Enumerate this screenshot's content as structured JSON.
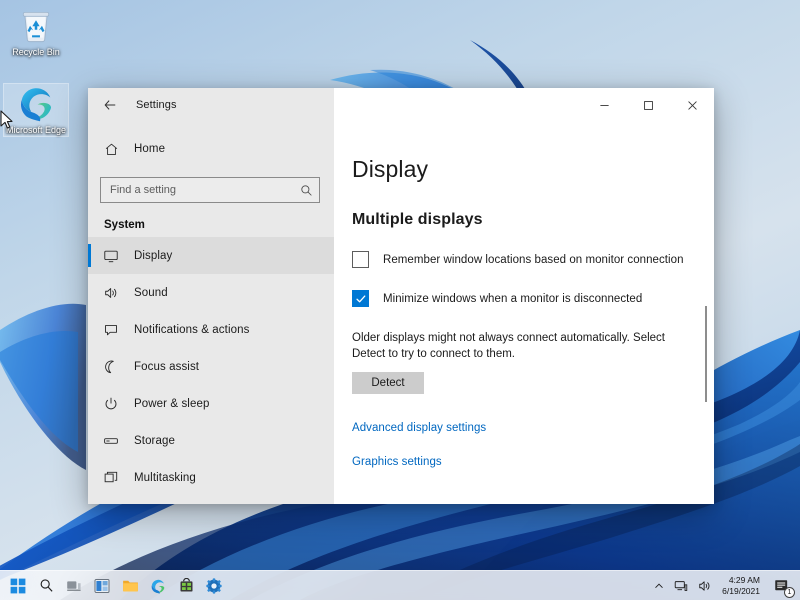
{
  "desktop": {
    "icons": [
      {
        "id": "recycle-bin",
        "label": "Recycle Bin",
        "icon": "recycle-bin-icon",
        "selected": false
      },
      {
        "id": "microsoft-edge",
        "label": "Microsoft Edge",
        "icon": "edge-icon",
        "selected": true
      }
    ],
    "wallpaper_colors": {
      "background_light": "#bcd3e8",
      "ribbon_blue": "#1152c4",
      "ribbon_deep": "#061a4a",
      "ribbon_bright": "#2f8fe8"
    }
  },
  "window": {
    "title": "Settings",
    "back_icon": "back-arrow-icon",
    "controls": {
      "minimize": {
        "label": "─",
        "name": "minimize-icon"
      },
      "maximize": {
        "label": "□",
        "name": "maximize-icon"
      },
      "close": {
        "label": "✕",
        "name": "close-icon"
      }
    }
  },
  "sidebar": {
    "home": {
      "label": "Home",
      "icon": "home-icon"
    },
    "search": {
      "placeholder": "Find a setting",
      "value": "",
      "icon": "search-icon"
    },
    "section_heading": "System",
    "items": [
      {
        "label": "Display",
        "icon": "monitor-icon",
        "selected": true
      },
      {
        "label": "Sound",
        "icon": "speaker-icon",
        "selected": false
      },
      {
        "label": "Notifications & actions",
        "icon": "notification-icon",
        "selected": false
      },
      {
        "label": "Focus assist",
        "icon": "moon-icon",
        "selected": false
      },
      {
        "label": "Power & sleep",
        "icon": "power-icon",
        "selected": false
      },
      {
        "label": "Storage",
        "icon": "storage-icon",
        "selected": false
      },
      {
        "label": "Multitasking",
        "icon": "multitasking-icon",
        "selected": false
      }
    ],
    "accent_color": "#0078d4"
  },
  "main": {
    "page_title": "Display",
    "group_title": "Multiple displays",
    "checkboxes": [
      {
        "label": "Remember window locations based on monitor connection",
        "checked": false
      },
      {
        "label": "Minimize windows when a monitor is disconnected",
        "checked": true
      }
    ],
    "detect_help": "Older displays might not always connect automatically. Select Detect to try to connect to them.",
    "detect_button": "Detect",
    "links": [
      {
        "label": "Advanced display settings"
      },
      {
        "label": "Graphics settings"
      }
    ],
    "link_color": "#0067c0"
  },
  "taskbar": {
    "apps": [
      {
        "name": "start-icon",
        "label": "Start"
      },
      {
        "name": "search-icon",
        "label": "Search"
      },
      {
        "name": "task-view-icon",
        "label": "Task View"
      },
      {
        "name": "widgets-icon",
        "label": "Widgets"
      },
      {
        "name": "file-explorer-icon",
        "label": "File Explorer"
      },
      {
        "name": "edge-icon",
        "label": "Microsoft Edge"
      },
      {
        "name": "store-icon",
        "label": "Microsoft Store"
      },
      {
        "name": "settings-icon",
        "label": "Settings"
      }
    ],
    "tray": {
      "chevron": {
        "name": "chevron-up-icon",
        "label": "Show hidden icons"
      },
      "network": {
        "name": "network-icon",
        "label": "Network"
      },
      "volume": {
        "name": "volume-icon",
        "label": "Volume"
      }
    },
    "clock": {
      "time": "4:29 AM",
      "date": "6/19/2021"
    },
    "notifications": {
      "name": "notification-center-icon",
      "count": "1"
    }
  }
}
